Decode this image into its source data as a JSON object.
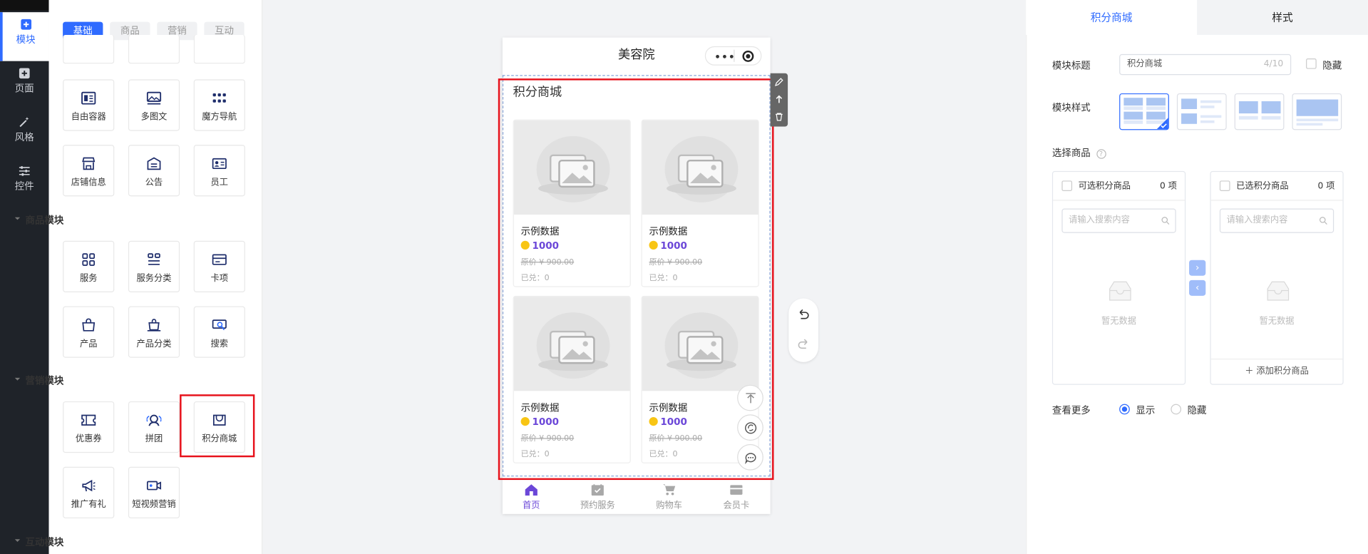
{
  "rail": [
    {
      "label": "模块",
      "icon": "plus-square-icon",
      "active": true
    },
    {
      "label": "页面",
      "icon": "page-plus-icon",
      "active": false
    },
    {
      "label": "风格",
      "icon": "magic-wand-icon",
      "active": false
    },
    {
      "label": "控件",
      "icon": "sliders-icon",
      "active": false
    }
  ],
  "component_tabs": [
    "基础",
    "商品",
    "营销",
    "互动"
  ],
  "basic_tiles": [
    {
      "label": "自由容器",
      "icon": "free-container-icon"
    },
    {
      "label": "多图文",
      "icon": "image-text-icon"
    },
    {
      "label": "魔方导航",
      "icon": "grid-dots-icon"
    },
    {
      "label": "店铺信息",
      "icon": "store-icon"
    },
    {
      "label": "公告",
      "icon": "notice-icon"
    },
    {
      "label": "员工",
      "icon": "staff-card-icon"
    }
  ],
  "sections": {
    "goods": "商品模块",
    "marketing": "营销模块",
    "interactive": "互动模块"
  },
  "goods_tiles": [
    {
      "label": "服务",
      "icon": "service-grid-icon"
    },
    {
      "label": "服务分类",
      "icon": "service-category-icon"
    },
    {
      "label": "卡项",
      "icon": "card-icon"
    },
    {
      "label": "产品",
      "icon": "product-bag-icon"
    },
    {
      "label": "产品分类",
      "icon": "product-category-icon"
    },
    {
      "label": "搜索",
      "icon": "search-icon"
    }
  ],
  "marketing_tiles": [
    {
      "label": "优惠券",
      "icon": "coupon-icon"
    },
    {
      "label": "拼团",
      "icon": "group-buy-icon"
    },
    {
      "label": "积分商城",
      "icon": "points-mall-icon",
      "highlighted": true
    },
    {
      "label": "推广有礼",
      "icon": "megaphone-icon"
    },
    {
      "label": "短视频营销",
      "icon": "video-icon"
    }
  ],
  "phone": {
    "title": "美容院",
    "module_title": "积分商城",
    "goods": [
      {
        "name": "示例数据",
        "points": "1000",
        "original_price": "原价 ¥ 900.00",
        "sold": "已兑：0"
      },
      {
        "name": "示例数据",
        "points": "1000",
        "original_price": "原价 ¥ 900.00",
        "sold": "已兑：0"
      },
      {
        "name": "示例数据",
        "points": "1000",
        "original_price": "原价 ¥ 900.00",
        "sold": "已兑：0"
      },
      {
        "name": "示例数据",
        "points": "1000",
        "original_price": "原价 ¥ 900.00",
        "sold": "已兑：0"
      }
    ],
    "tabbar": [
      {
        "label": "首页",
        "icon": "home-icon",
        "active": true
      },
      {
        "label": "预约服务",
        "icon": "calendar-check-icon",
        "active": false
      },
      {
        "label": "购物车",
        "icon": "cart-icon",
        "active": false
      },
      {
        "label": "会员卡",
        "icon": "member-card-icon",
        "active": false
      }
    ]
  },
  "right_panel": {
    "tabs": [
      "积分商城",
      "样式"
    ],
    "title_label": "模块标题",
    "title_value": "积分商城",
    "title_count": "4/10",
    "hide_label": "隐藏",
    "style_label": "模块样式",
    "select_label": "选择商品",
    "left_box": {
      "title": "可选积分商品",
      "count": "0 项",
      "placeholder": "请输入搜索内容",
      "empty": "暂无数据"
    },
    "right_box": {
      "title": "已选积分商品",
      "count": "0 项",
      "placeholder": "请输入搜索内容",
      "empty": "暂无数据",
      "add": "＋ 添加积分商品"
    },
    "more_label": "查看更多",
    "show_label": "显示",
    "hide_label2": "隐藏"
  },
  "colors": {
    "accent": "#2f6bff",
    "highlight": "#e7101a",
    "points": "#6b47d8"
  }
}
